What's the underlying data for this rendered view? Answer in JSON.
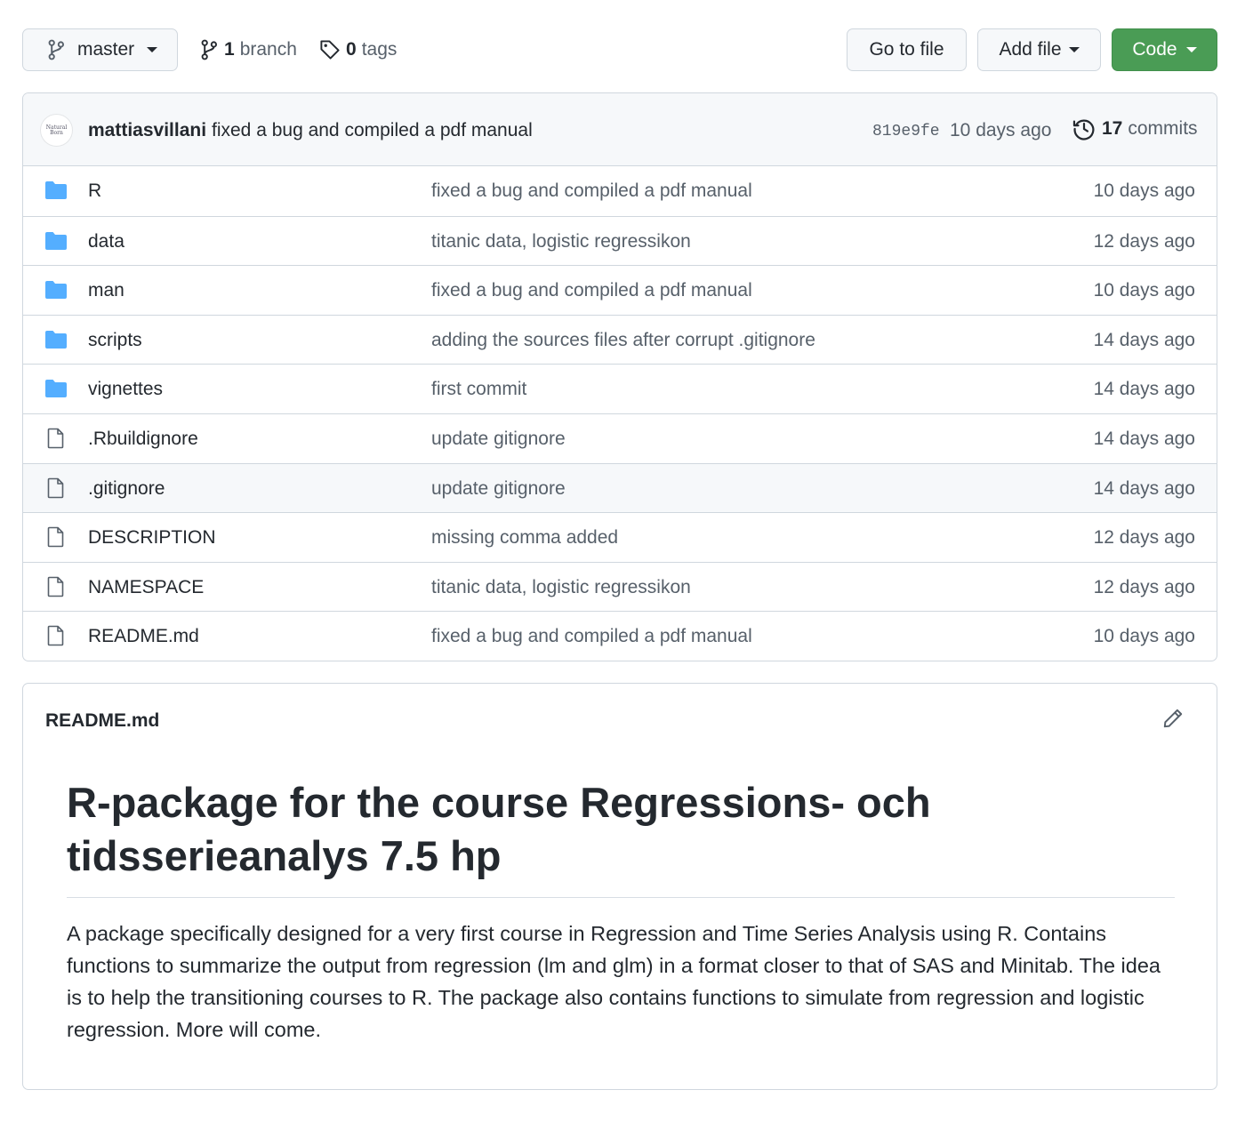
{
  "toolbar": {
    "branch_name": "master",
    "branch_count": "1",
    "branch_label": "branch",
    "tag_count": "0",
    "tag_label": "tags",
    "goto_file_label": "Go to file",
    "add_file_label": "Add file",
    "code_label": "Code",
    "code_color": "#4a9c55"
  },
  "latest_commit": {
    "avatar_text": "Natural Born",
    "author": "mattiasvillani",
    "message": "fixed a bug and compiled a pdf manual",
    "sha": "819e9fe",
    "age": "10 days ago",
    "commit_count": "17",
    "commit_label": "commits"
  },
  "files": [
    {
      "type": "folder",
      "name": "R",
      "message": "fixed a bug and compiled a pdf manual",
      "age": "10 days ago"
    },
    {
      "type": "folder",
      "name": "data",
      "message": "titanic data, logistic regressikon",
      "age": "12 days ago"
    },
    {
      "type": "folder",
      "name": "man",
      "message": "fixed a bug and compiled a pdf manual",
      "age": "10 days ago"
    },
    {
      "type": "folder",
      "name": "scripts",
      "message": "adding the sources files after corrupt .gitignore",
      "age": "14 days ago"
    },
    {
      "type": "folder",
      "name": "vignettes",
      "message": "first commit",
      "age": "14 days ago"
    },
    {
      "type": "file",
      "name": ".Rbuildignore",
      "message": "update gitignore",
      "age": "14 days ago"
    },
    {
      "type": "file",
      "name": ".gitignore",
      "message": "update gitignore",
      "age": "14 days ago"
    },
    {
      "type": "file",
      "name": "DESCRIPTION",
      "message": "missing comma added",
      "age": "12 days ago"
    },
    {
      "type": "file",
      "name": "NAMESPACE",
      "message": "titanic data, logistic regressikon",
      "age": "12 days ago"
    },
    {
      "type": "file",
      "name": "README.md",
      "message": "fixed a bug and compiled a pdf manual",
      "age": "10 days ago"
    }
  ],
  "readme": {
    "filename": "README.md",
    "heading": "R-package for the course Regressions- och tidsserieanalys 7.5 hp",
    "paragraph": "A package specifically designed for a very first course in Regression and Time Series Analysis using R. Contains functions to summarize the output from regression (lm and glm) in a format closer to that of SAS and Minitab. The idea is to help the transitioning courses to R. The package also contains functions to simulate from regression and logistic regression. More will come."
  },
  "icons": {
    "folder_color": "#54aeff",
    "file_color": "#57606a"
  }
}
